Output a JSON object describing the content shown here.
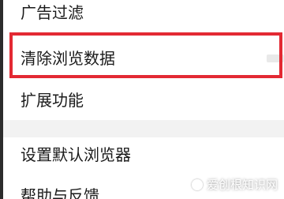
{
  "settings": {
    "items": [
      {
        "label": "广告过滤"
      },
      {
        "label": "清除浏览数据"
      },
      {
        "label": "扩展功能"
      },
      {
        "label": "设置默认浏览器"
      },
      {
        "label": "帮助与反馈"
      }
    ]
  },
  "watermark": {
    "text": "爱创根知识网"
  },
  "colors": {
    "highlight": "#e32933",
    "divider_gap": "#f2f2f2"
  }
}
